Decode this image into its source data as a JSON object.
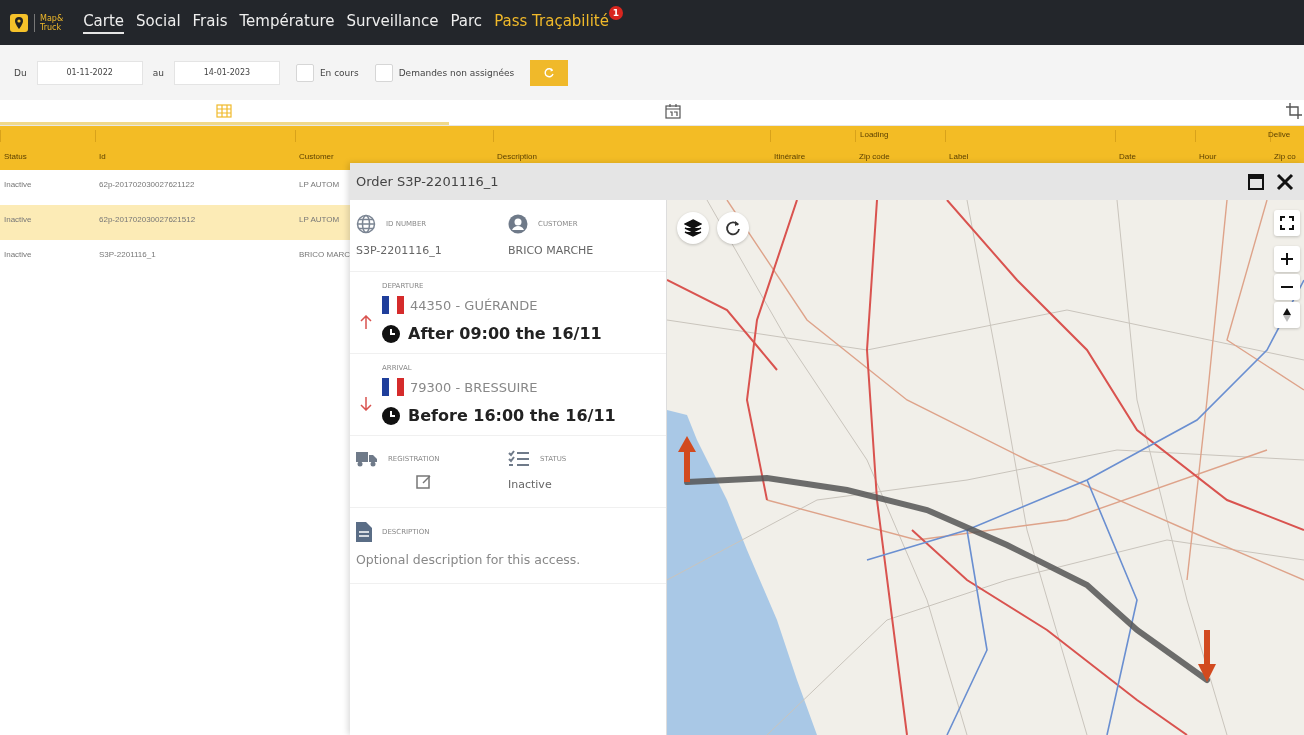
{
  "app": {
    "logo_text": [
      "Map&",
      "Truck"
    ]
  },
  "nav": [
    {
      "label": "Carte",
      "selected": true,
      "highlighted": false
    },
    {
      "label": "Social",
      "selected": false,
      "highlighted": false
    },
    {
      "label": "Frais",
      "selected": false,
      "highlighted": false
    },
    {
      "label": "Température",
      "selected": false,
      "highlighted": false
    },
    {
      "label": "Surveillance",
      "selected": false,
      "highlighted": false
    },
    {
      "label": "Parc",
      "selected": false,
      "highlighted": false
    },
    {
      "label": "Pass Traçabilité",
      "selected": false,
      "highlighted": true,
      "badge": "1"
    }
  ],
  "filters": {
    "from_label": "Du",
    "from": "01-11-2022",
    "to_label": "au",
    "to": "14-01-2023",
    "checkboxes": [
      {
        "label": "En cours",
        "checked": false
      },
      {
        "label": "Demandes non assignées",
        "checked": false
      }
    ]
  },
  "view_tabs": [
    {
      "kind": "grid",
      "selected": true
    },
    {
      "kind": "calendar",
      "selected": false
    },
    {
      "kind": "crop",
      "selected": false
    }
  ],
  "table": {
    "groups": [
      {
        "label": "Loading"
      },
      {
        "label": "Delive"
      }
    ],
    "columns": [
      "Status",
      "Id",
      "Customer",
      "Description",
      "Itinéraire",
      "Zip code",
      "Label",
      "Date",
      "Hour",
      "Zip co"
    ],
    "rows": [
      {
        "cells": [
          "Inactive",
          "62p-201702030027621122",
          "LP AUTOM"
        ],
        "selected": false
      },
      {
        "cells": [
          "Inactive",
          "62p-201702030027621512",
          "LP AUTOM"
        ],
        "selected": true
      },
      {
        "cells": [
          "Inactive",
          "S3P-2201116_1",
          "BRICO MARC"
        ],
        "selected": false
      }
    ]
  },
  "order": {
    "title": "Order S3P-2201116_1",
    "id_label": "ID NUMBER",
    "id": "S3P-2201116_1",
    "customer_label": "CUSTOMER",
    "customer": "BRICO MARCHE",
    "stops": [
      {
        "kind": "departure",
        "label": "DEPARTURE",
        "place": "44350 - GUÉRANDE",
        "time": "After 09:00 the 16/11"
      },
      {
        "kind": "arrival",
        "label": "ARRIVAL",
        "place": "79300 - BRESSUIRE",
        "time": "Before 16:00 the 16/11"
      }
    ],
    "registration_label": "REGISTRATION",
    "status_label": "STATUS",
    "status": "Inactive",
    "description_label": "DESCRIPTION",
    "description": "Optional description for this access."
  }
}
